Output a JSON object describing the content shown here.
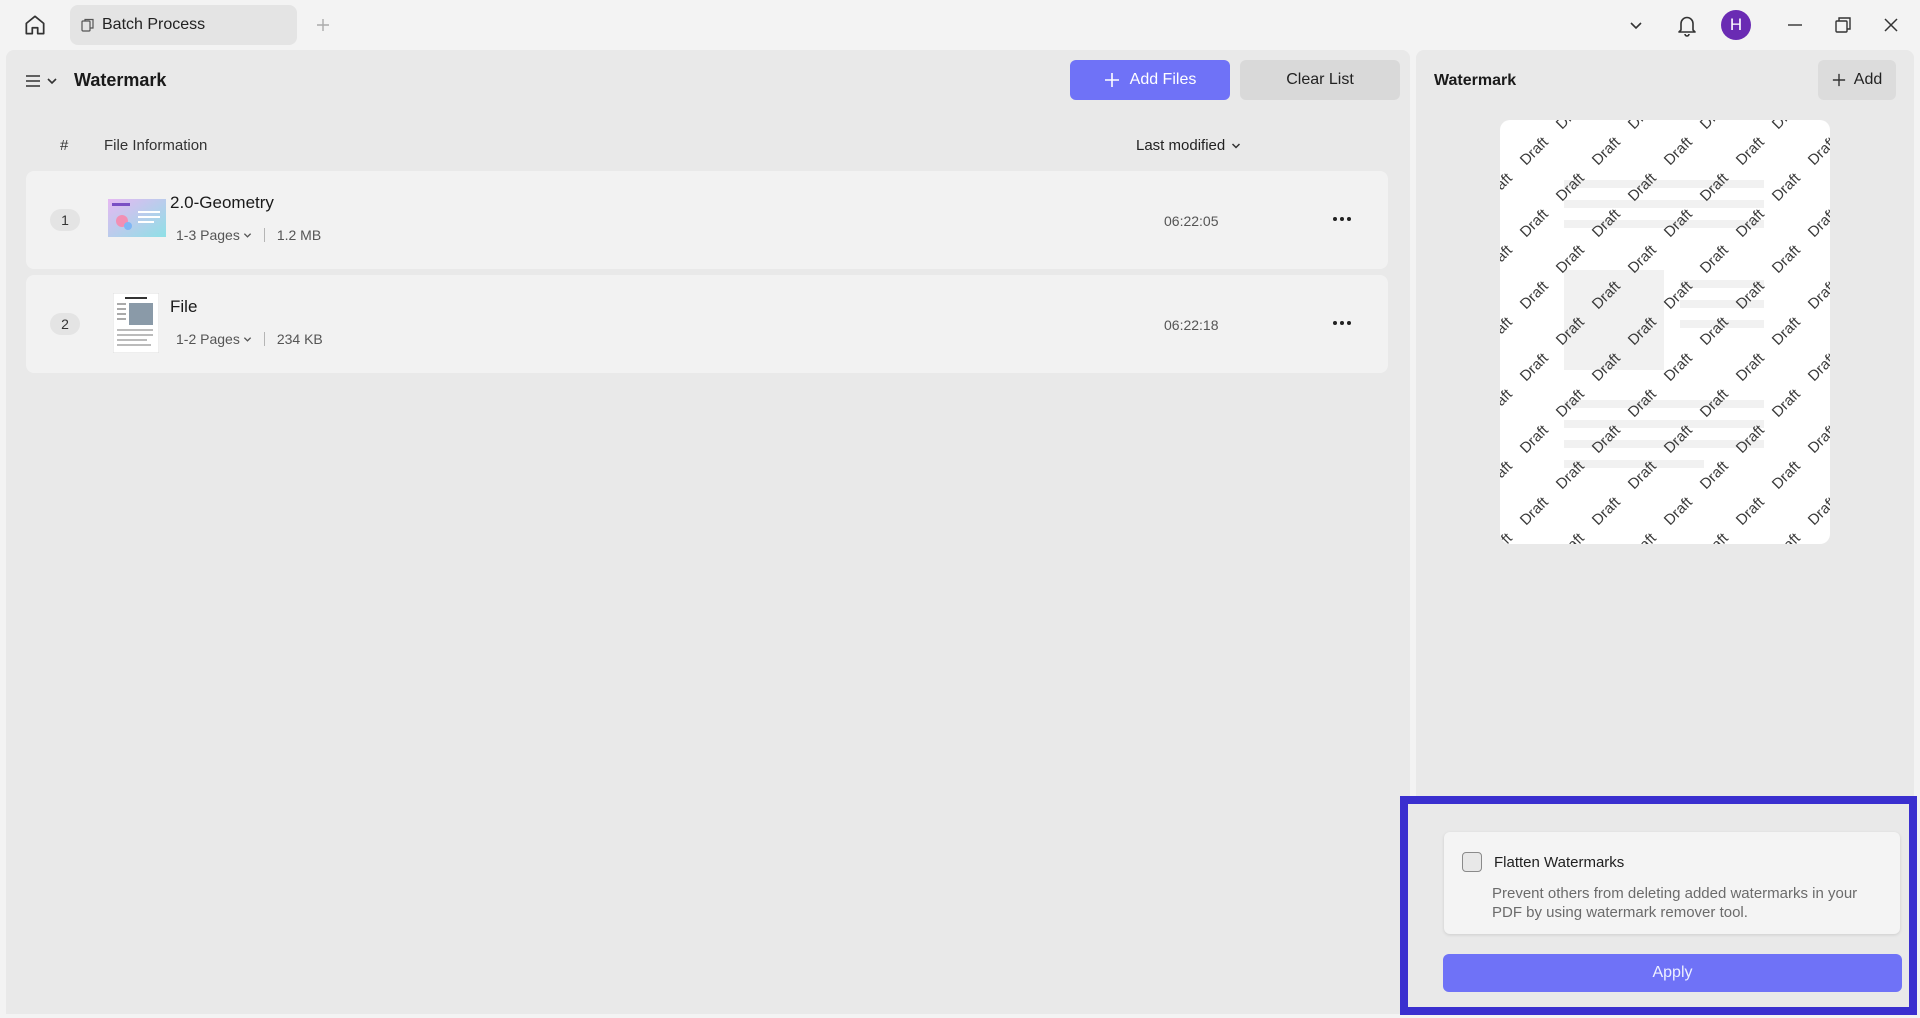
{
  "titlebar": {
    "tab_label": "Batch Process",
    "avatar_initial": "H"
  },
  "left_panel": {
    "title": "Watermark",
    "add_files_label": "Add Files",
    "clear_list_label": "Clear List",
    "columns": {
      "hash": "#",
      "info": "File Information",
      "sort": "Last modified"
    },
    "files": [
      {
        "num": "1",
        "name": "2.0-Geometry",
        "pages": "1-3 Pages",
        "size": "1.2 MB",
        "time": "06:22:05"
      },
      {
        "num": "2",
        "name": "File",
        "pages": "1-2 Pages",
        "size": "234 KB",
        "time": "06:22:18"
      }
    ]
  },
  "right_panel": {
    "title": "Watermark",
    "add_label": "Add",
    "watermark_text": "Draft"
  },
  "flatten": {
    "label": "Flatten Watermarks",
    "description": "Prevent others from deleting added watermarks in your PDF by using watermark remover tool.",
    "checked": false
  },
  "apply_label": "Apply",
  "colors": {
    "accent": "#6f72f7",
    "highlight_border": "#3a2fcf",
    "avatar": "#6a2bb3"
  }
}
